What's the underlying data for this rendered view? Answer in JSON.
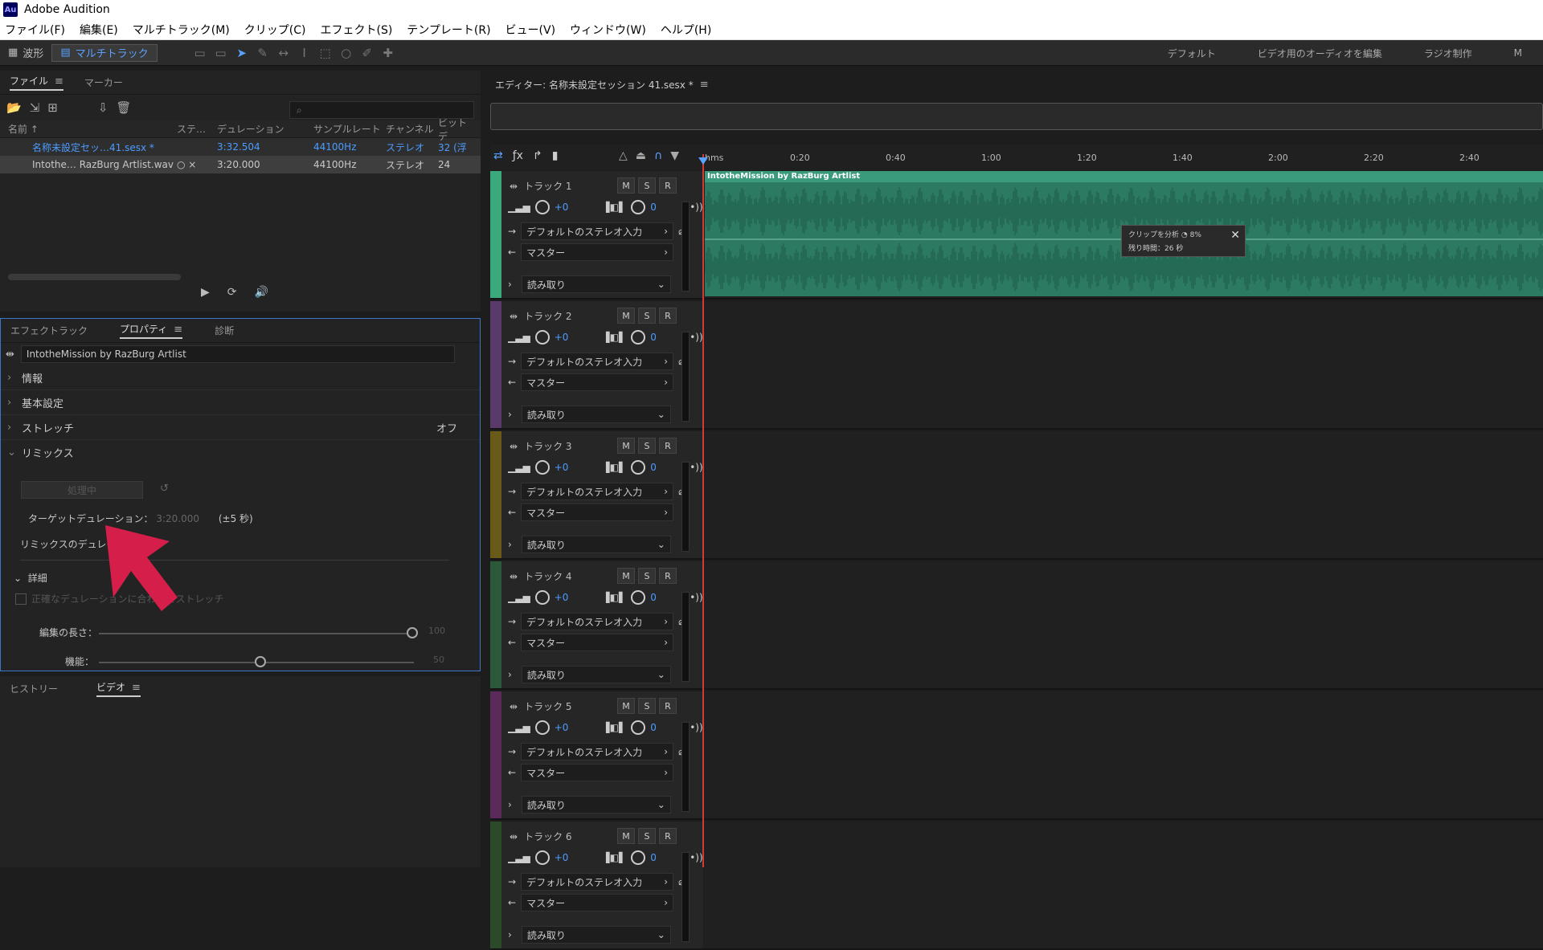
{
  "app": {
    "title": "Adobe Audition",
    "logo": "Au"
  },
  "menu": [
    "ファイル(F)",
    "編集(E)",
    "マルチトラック(M)",
    "クリップ(C)",
    "エフェクト(S)",
    "テンプレート(R)",
    "ビュー(V)",
    "ウィンドウ(W)",
    "ヘルプ(H)"
  ],
  "toolbar": {
    "waveform_label": "波形",
    "multitrack_label": "マルチトラック"
  },
  "workspaces": [
    "デフォルト",
    "ビデオ用のオーディオを編集",
    "ラジオ制作",
    "M"
  ],
  "files_panel": {
    "tabs": [
      "ファイル",
      "マーカー"
    ],
    "columns": [
      "名前 ↑",
      "ステ…",
      "デュレーション",
      "サンプルレート",
      "チャンネル",
      "ビットデ"
    ],
    "rows": [
      {
        "name": "名称未設定セッ…41.sesx *",
        "status": "",
        "duration": "3:32.504",
        "rate": "44100Hz",
        "channels": "ステレオ",
        "bits": "32 (浮"
      },
      {
        "name": "Intothe… RazBurg Artlist.wav",
        "status": "○ ×",
        "duration": "3:20.000",
        "rate": "44100Hz",
        "channels": "ステレオ",
        "bits": "24"
      }
    ]
  },
  "properties_panel": {
    "tabs": [
      "エフェクトラック",
      "プロパティ",
      "診断"
    ],
    "clip_name": "IntotheMission by RazBurg Artlist",
    "sections": [
      "情報",
      "基本設定",
      "ストレッチ",
      "リミックス"
    ],
    "stretch_value": "オフ",
    "processing_label": "処理中",
    "target_duration_label": "ターゲットデュレーション：",
    "target_duration_value": "3:20.000",
    "target_tolerance": "(±5 秒)",
    "remix_duration_label": "リミックスのデュレーション",
    "detail_label": "詳細",
    "exact_checkbox_label": "正確なデュレーションに合わせてストレッチ",
    "edit_length_label": "編集の長さ：",
    "features_label": "機能：",
    "edit_length_max": "100",
    "features_max": "50"
  },
  "bottom_panel": {
    "tabs": [
      "ヒストリー",
      "ビデオ"
    ]
  },
  "editor": {
    "title": "エディター: 名称未設定セッション 41.sesx *",
    "ruler": [
      "hms",
      "0:20",
      "0:40",
      "1:00",
      "1:20",
      "1:40",
      "2:00",
      "2:20",
      "2:40"
    ],
    "clip_title": "IntotheMission by RazBurg Artlist",
    "popup_line1": "クリップを分析",
    "popup_percent": "8%",
    "popup_line2": "残り時間：26 秒",
    "tracks": [
      {
        "name": "トラック 1",
        "color": "#3aaa7c"
      },
      {
        "name": "トラック 2",
        "color": "#5a3a6a"
      },
      {
        "name": "トラック 3",
        "color": "#6a5a1a"
      },
      {
        "name": "トラック 4",
        "color": "#2a5a3a"
      },
      {
        "name": "トラック 5",
        "color": "#5a2a5a"
      },
      {
        "name": "トラック 6",
        "color": "#2a4a2a"
      }
    ],
    "track_labels": {
      "m": "M",
      "s": "S",
      "r": "R",
      "vol": "+0",
      "pan": "0",
      "input": "デフォルトのステレオ入力",
      "output": "マスター",
      "automation": "読み取り"
    }
  }
}
